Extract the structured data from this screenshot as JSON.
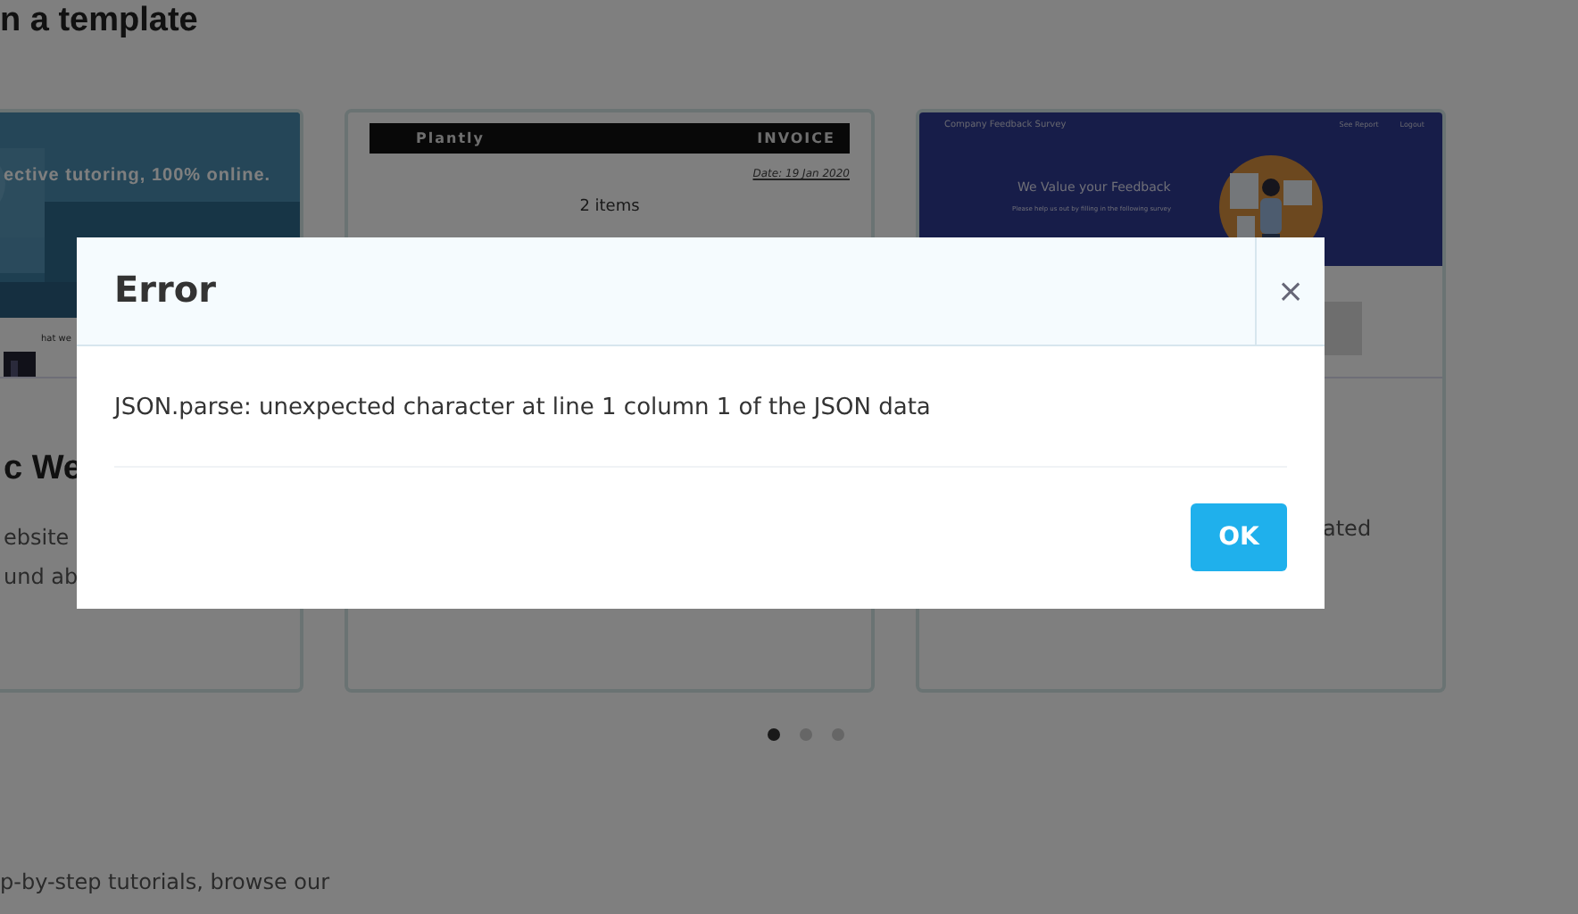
{
  "page": {
    "heading": "n a template",
    "templates": [
      {
        "kind": "website",
        "headline": "ective tutoring, 100% online.",
        "section_label": "hat we",
        "title": "c We",
        "description_lines": [
          "ebsite",
          "und ab"
        ]
      },
      {
        "kind": "invoice",
        "brand": "Plantly",
        "doc_title": "INVOICE",
        "date": "Date: 19 Jan 2020",
        "items": "2 items"
      },
      {
        "kind": "survey",
        "app_title": "Company Feedback Survey",
        "nav": [
          "See Report",
          "Logout"
        ],
        "headline": "We Value your Feedback",
        "subtitle": "Please help us out by filling in the following survey",
        "description_lines": [
          "ated"
        ]
      }
    ],
    "carousel_dots": [
      {
        "selected": true
      },
      {
        "selected": false
      },
      {
        "selected": false
      }
    ],
    "footer_text": "p-by-step tutorials, browse our"
  },
  "dialog": {
    "title": "Error",
    "close": "×",
    "message": "JSON.parse: unexpected character at line 1 column 1 of the JSON data",
    "button": "OK"
  }
}
